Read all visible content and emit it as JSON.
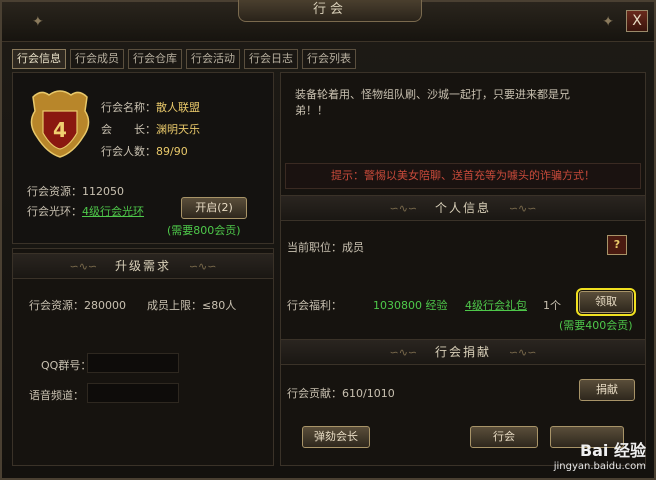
{
  "window": {
    "title": "行会",
    "close_label": "X"
  },
  "tabs": [
    {
      "label": "行会信息",
      "active": true
    },
    {
      "label": "行会成员",
      "active": false
    },
    {
      "label": "行会仓库",
      "active": false
    },
    {
      "label": "行会活动",
      "active": false
    },
    {
      "label": "行会日志",
      "active": false
    },
    {
      "label": "行会列表",
      "active": false
    }
  ],
  "guild": {
    "emblem_level": "4",
    "name_label": "行会名称：",
    "name_value": "散人联盟",
    "leader_label": "会　　长：",
    "leader_value": "渊明天乐",
    "members_label": "行会人数：",
    "members_value": "89/90",
    "resource_label": "行会资源：",
    "resource_value": "112050",
    "aura_label": "行会光环：",
    "aura_value": "4级行会光环",
    "open_button": "开启(2)",
    "open_need": "(需要800会贡)"
  },
  "upgrade": {
    "header": "升级需求",
    "resource_text": "行会资源：280000",
    "member_limit_text": "成员上限：≤80人",
    "qq_label": "QQ群号：",
    "voice_label": "语音频道："
  },
  "notice": {
    "text": "装备轮着用、怪物组队刷、沙城一起打，只要进来都是兄弟！！",
    "tip": "提示：警惕以美女陪聊、送首充等为噱头的诈骗方式！"
  },
  "personal": {
    "header": "个人信息",
    "position_text": "当前职位：成员",
    "help_label": "?",
    "welfare_label": "行会福利：",
    "exp_value": "1030800 经验",
    "gift_link": "4级行会礼包",
    "gift_count": "1个",
    "claim_button": "领取",
    "claim_need": "(需要400会贡)"
  },
  "donate": {
    "header": "行会捐献",
    "contrib_text": "行会贡献：610/1010",
    "donate_button": "捐献",
    "impeach_button": "弹劾会长",
    "quit_button": "行会"
  },
  "watermark": {
    "logo": "Bai 经验",
    "url": "jingyan.baidu.com"
  },
  "colors": {
    "gold": "#e8c86a",
    "green": "#4ec84a",
    "tip_red": "#d84a3a",
    "highlight": "#f0e020"
  }
}
